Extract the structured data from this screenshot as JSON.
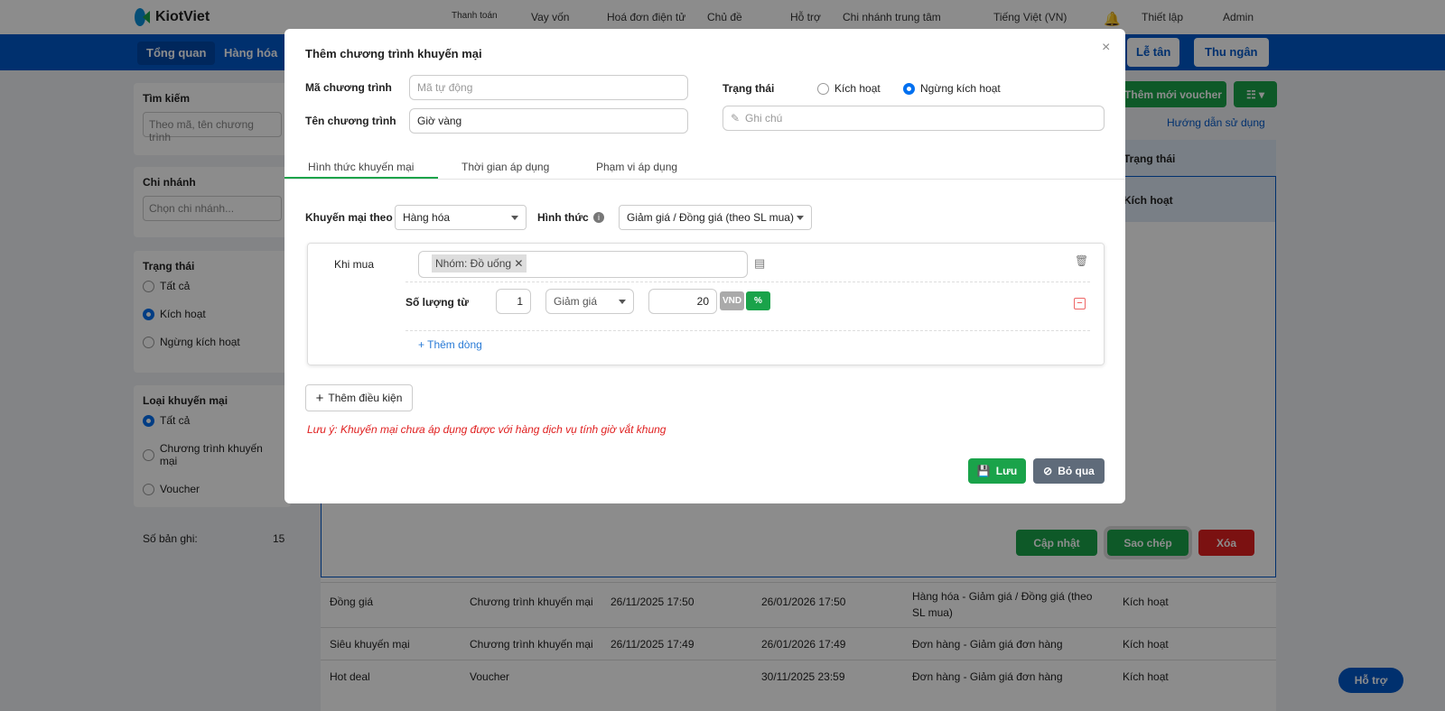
{
  "header": {
    "logo": "KiotViet",
    "items": [
      "Thanh toán",
      "Vay vốn",
      "Hoá đơn điện tử",
      "Chủ đề",
      "Hỗ trợ",
      "Chi nhánh trung tâm",
      "Tiếng Việt (VN)",
      "Thiết lập",
      "Admin"
    ]
  },
  "nav": {
    "tabs": [
      "Tổng quan",
      "Hàng hóa"
    ],
    "right": [
      "Lễ tân",
      "Thu ngân"
    ]
  },
  "sidebar": {
    "search_title": "Tìm kiếm",
    "search_placeholder": "Theo mã, tên chương trình",
    "branch_title": "Chi nhánh",
    "branch_placeholder": "Chọn chi nhánh...",
    "status_title": "Trạng thái",
    "status_options": [
      "Tất cả",
      "Kích hoạt",
      "Ngừng kích hoạt"
    ],
    "type_title": "Loại khuyến mại",
    "type_options": [
      "Tất cả",
      "Chương trình khuyến mại",
      "Voucher"
    ],
    "records_label": "Số bản ghi:",
    "records_value": "15"
  },
  "main": {
    "add_voucher": "Thêm mới voucher",
    "guide": "Hướng dẫn sử dụng",
    "col_status": "Trạng thái",
    "selected_status": "Kích hoạt",
    "update": "Cập nhật",
    "copy": "Sao chép",
    "delete": "Xóa",
    "rows": [
      {
        "name": "Đồng giá",
        "type": "Chương trình khuyến mại",
        "from": "26/11/2025 17:50",
        "to": "26/01/2026 17:50",
        "form": "Hàng hóa - Giảm giá / Đồng giá (theo SL mua)",
        "status": "Kích hoạt"
      },
      {
        "name": "Siêu khuyến mại",
        "type": "Chương trình khuyến mại",
        "from": "26/11/2025 17:49",
        "to": "26/01/2026 17:49",
        "form": "Đơn hàng - Giảm giá đơn hàng",
        "status": "Kích hoạt"
      },
      {
        "name": "Hot deal",
        "type": "Voucher",
        "from": "",
        "to": "30/11/2025 23:59",
        "form": "Đơn hàng - Giảm giá đơn hàng",
        "status": "Kích hoạt"
      }
    ]
  },
  "support": "Hỗ trợ",
  "modal": {
    "title": "Thêm chương trình khuyến mại",
    "code_label": "Mã chương trình",
    "code_placeholder": "Mã tự động",
    "name_label": "Tên chương trình",
    "name_value": "Giờ vàng",
    "status_label": "Trạng thái",
    "status_active": "Kích hoạt",
    "status_inactive": "Ngừng kích hoạt",
    "note_placeholder": "Ghi chú",
    "tabs": [
      "Hình thức khuyến mại",
      "Thời gian áp dụng",
      "Phạm vi áp dụng"
    ],
    "promo_by_label": "Khuyến mại theo",
    "promo_by_value": "Hàng hóa",
    "form_label": "Hình thức",
    "form_value": "Giảm giá / Đồng giá (theo SL mua)",
    "when_buy": "Khi mua",
    "tag": "Nhóm: Đồ uống",
    "qty_label": "Số lượng từ",
    "qty_value": "1",
    "discount_type": "Giảm giá",
    "discount_value": "20",
    "unit_vnd": "VND",
    "unit_pct": "%",
    "add_line": "+ Thêm dòng",
    "add_condition": "Thêm điều kiện",
    "note": "Lưu ý: Khuyến mại chưa áp dụng được với hàng dịch vụ tính giờ vắt khung",
    "save": "Lưu",
    "cancel": "Bỏ qua"
  }
}
